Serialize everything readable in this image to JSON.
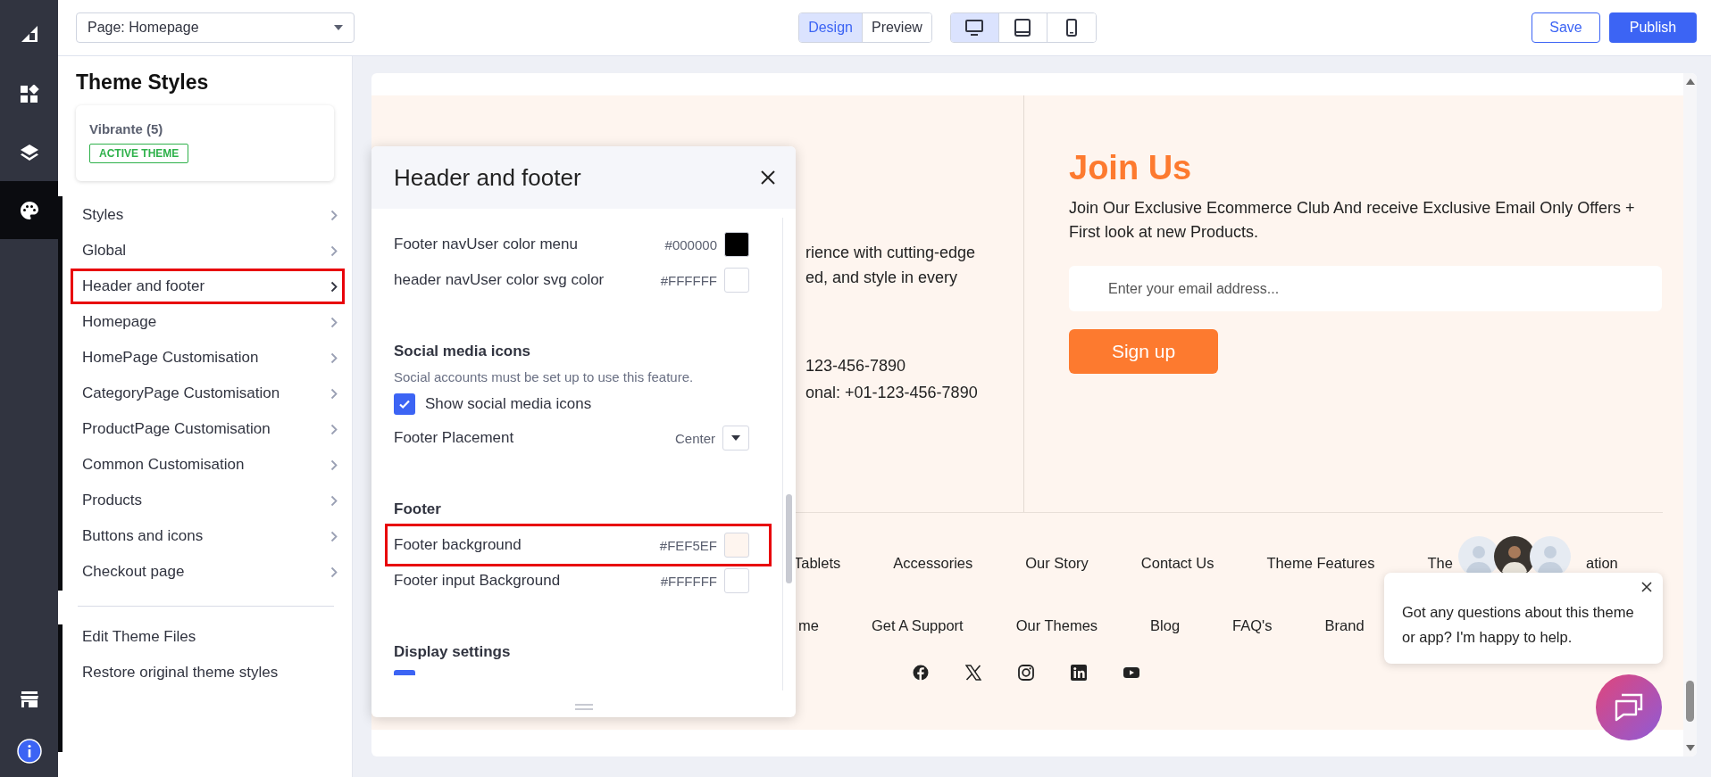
{
  "rail": [
    {
      "kind": "widgets",
      "selected": false
    },
    {
      "kind": "layers",
      "selected": false
    },
    {
      "kind": "palette",
      "selected": true
    }
  ],
  "rail_bottom": [
    {
      "kind": "store"
    },
    {
      "kind": "info"
    }
  ],
  "top_bar": {
    "page_select": "Page: Homepage",
    "modes": [
      {
        "label": "Design",
        "selected": true
      },
      {
        "label": "Preview",
        "selected": false
      }
    ],
    "devices": [
      {
        "kind": "desktop",
        "selected": true
      },
      {
        "kind": "tablet",
        "selected": false
      },
      {
        "kind": "phone",
        "selected": false
      }
    ],
    "save": "Save",
    "publish": "Publish"
  },
  "sidebar": {
    "title": "Theme Styles",
    "theme": {
      "name": "Vibrante (5)",
      "badge": "ACTIVE THEME"
    },
    "items": [
      {
        "label": "Styles",
        "highlighted": false
      },
      {
        "label": "Global",
        "highlighted": false
      },
      {
        "label": "Header and footer",
        "highlighted": true
      },
      {
        "label": "Homepage",
        "highlighted": false
      },
      {
        "label": "HomePage Customisation",
        "highlighted": false
      },
      {
        "label": "CategoryPage Customisation",
        "highlighted": false
      },
      {
        "label": "ProductPage Customisation",
        "highlighted": false
      },
      {
        "label": "Common Customisation",
        "highlighted": false
      },
      {
        "label": "Products",
        "highlighted": false
      },
      {
        "label": "Buttons and icons",
        "highlighted": false
      },
      {
        "label": "Checkout page",
        "highlighted": false
      }
    ],
    "links": [
      "Edit Theme Files",
      "Restore original theme styles"
    ]
  },
  "panel": {
    "title": "Header and footer",
    "rows": [
      {
        "kind": "color",
        "label": "Footer navUser color menu",
        "value": "#000000",
        "highlighted": false
      },
      {
        "kind": "color",
        "label": "header navUser color svg color",
        "value": "#FFFFFF",
        "highlighted": false
      },
      {
        "kind": "heading",
        "label": "Social media icons"
      },
      {
        "kind": "note",
        "label": "Social accounts must be set up to use this feature."
      },
      {
        "kind": "checkbox",
        "label": "Show social media icons",
        "checked": true
      },
      {
        "kind": "select",
        "label": "Footer Placement",
        "value": "Center"
      },
      {
        "kind": "heading",
        "label": "Footer"
      },
      {
        "kind": "color",
        "label": "Footer background",
        "value": "#FEF5EF",
        "highlighted": true
      },
      {
        "kind": "color",
        "label": "Footer input Background",
        "value": "#FFFFFF",
        "highlighted": false
      },
      {
        "kind": "heading",
        "label": "Display settings"
      },
      {
        "kind": "checkbox_stub",
        "checked": true
      }
    ]
  },
  "preview": {
    "about_fragments": [
      "rience with cutting-edge",
      "ed, and style in every"
    ],
    "contact_fragments": [
      "123-456-7890",
      "onal: +01-123-456-7890"
    ],
    "join": {
      "title": "Join Us",
      "text": "Join Our Exclusive Ecommerce Club And receive Exclusive Email Only Offers + First look at new Products.",
      "placeholder": "Enter your email address...",
      "button": "Sign up"
    },
    "links_row_1": [
      "Tablets",
      "Accessories",
      "Our Story",
      "Contact Us",
      "Theme Features",
      "The",
      "ation"
    ],
    "links_row_2": [
      "me",
      "Get A Support",
      "Our Themes",
      "Blog",
      "FAQ's",
      "Brand"
    ],
    "social": [
      {
        "kind": "facebook"
      },
      {
        "kind": "x"
      },
      {
        "kind": "instagram"
      },
      {
        "kind": "linkedin"
      },
      {
        "kind": "youtube"
      }
    ]
  },
  "chat": {
    "message": "Got any questions about this theme or app? I'm happy to help."
  }
}
